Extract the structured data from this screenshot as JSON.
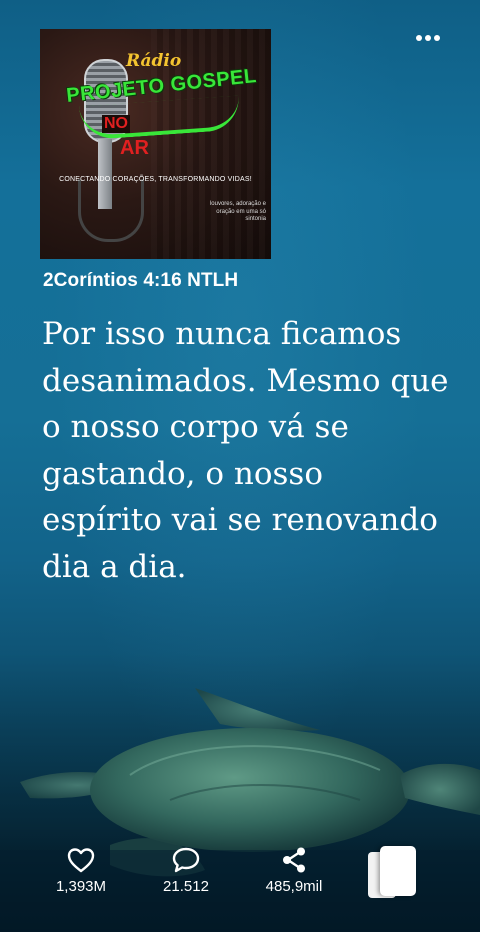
{
  "cover": {
    "radio_word": "Rádio",
    "brand": "PROJETO GOSPEL",
    "no_word": "NO",
    "ar_word": "AR",
    "tagline": "CONECTANDO CORAÇÕES, TRANSFORMANDO VIDAS!",
    "small_text": "louvores, adoração e oração em uma só sintonia"
  },
  "post": {
    "reference": "2Coríntios 4:16 NTLH",
    "verse": "Por isso nunca ficamos desanimados. Mesmo que o nosso corpo vá se gastando, o nosso espírito vai se renovando dia a dia."
  },
  "actions": {
    "likes": "1,393M",
    "comments": "21.512",
    "shares": "485,9mil"
  },
  "icons": {
    "more": "more-dots-icon",
    "like": "heart-icon",
    "comment": "comment-bubble-icon",
    "share": "share-icon",
    "cards": "stacked-cards-icon"
  }
}
